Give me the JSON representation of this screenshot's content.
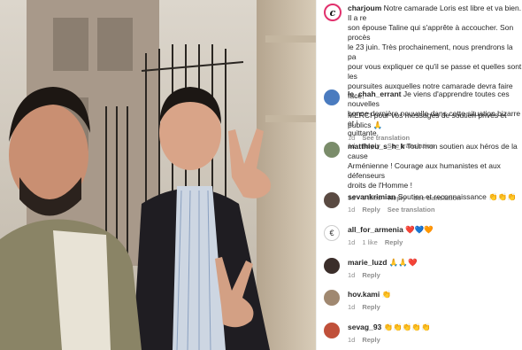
{
  "post": {
    "username": "charjoum",
    "caption": "Notre camarade Loris est libre et va bien. Il a re\nson épouse Taline qui s'apprête à accoucher. Son procès\nle 23 juin. Très prochainement, nous prendrons la pa\npour vous expliquer ce qu'il se passe et quelles sont les\npoursuites auxquelles notre camarade devra faire face.\n\nMERCI pour vos messages de soutien privés et publics 🙏",
    "age": "1d",
    "see_translation": "See translation"
  },
  "comments": [
    {
      "username": "le_chah_errant",
      "text": "Je viens d'apprendre toutes ces nouvelles\nbonne dernière nouvelle dans cette situation bizarre et i\nquittante.",
      "age": "1d",
      "likes": "",
      "reply": "Reply",
      "see_translation": "See translation"
    },
    {
      "username": "matthieu_s_h_k",
      "text": "Tout mon soutien aux héros de la cause\nArménienne ! Courage aux humanistes et aux défenseurs\ndroits de l'Homme !",
      "age": "1d",
      "likes": "3 likes",
      "reply": "Reply",
      "see_translation": "See translation"
    },
    {
      "username": "sevankrimian",
      "text": "Soutien et reconnaissance 👏👏👏",
      "age": "1d",
      "likes": "",
      "reply": "Reply",
      "see_translation": "See translation"
    },
    {
      "username": "all_for_armenia",
      "text": "❤️💙🧡",
      "age": "1d",
      "likes": "1 like",
      "reply": "Reply",
      "see_translation": ""
    },
    {
      "username": "marie_luzd",
      "text": "🙏🙏❤️",
      "age": "1d",
      "likes": "",
      "reply": "Reply",
      "see_translation": ""
    },
    {
      "username": "hov.kami",
      "text": "👏",
      "age": "1d",
      "likes": "",
      "reply": "Reply",
      "see_translation": ""
    },
    {
      "username": "sevag_93",
      "text": "👏👏👏👏👏",
      "age": "1d",
      "likes": "",
      "reply": "Reply",
      "see_translation": ""
    }
  ],
  "colors": {
    "text": "#262626",
    "meta": "#8e8e8e",
    "logo_ring": "#e1306c"
  }
}
